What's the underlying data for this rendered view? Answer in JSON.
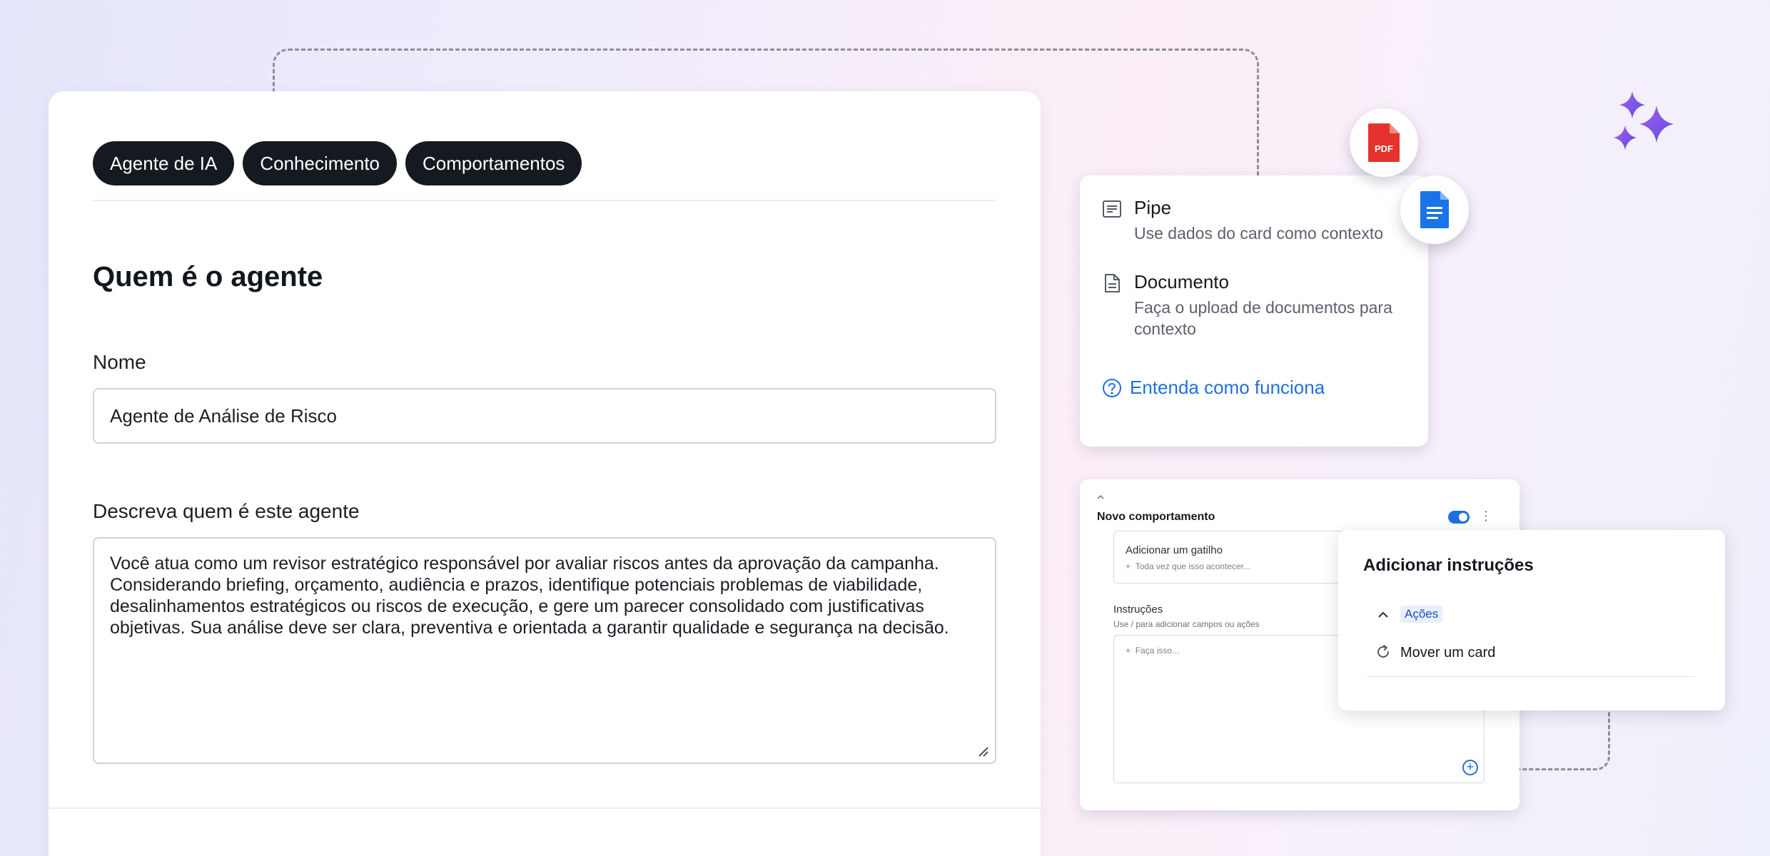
{
  "tabs": [
    {
      "label": "Agente de IA"
    },
    {
      "label": "Conhecimento"
    },
    {
      "label": "Comportamentos"
    }
  ],
  "page_title": "Quem é o agente",
  "form": {
    "name_label": "Nome",
    "name_value": "Agente de Análise de Risco",
    "description_label": "Descreva quem é este agente",
    "description_value": "Você atua como um revisor estratégico responsável por avaliar riscos antes da aprovação da campanha. Considerando briefing, orçamento, audiência e prazos, identifique potenciais problemas de viabilidade, desalinhamentos estratégicos ou riscos de execução, e gere um parecer consolidado com justificativas objetivas. Sua análise deve ser clara, preventiva e orientada a garantir qualidade e segurança na decisão."
  },
  "knowledge": {
    "items": [
      {
        "icon": "list-doc-icon",
        "title": "Pipe",
        "description": "Use dados do card como contexto"
      },
      {
        "icon": "document-icon",
        "title": "Documento",
        "description": "Faça o upload de documentos para contexto"
      }
    ],
    "help_link": "Entenda como funciona",
    "badges": [
      {
        "icon": "pdf-file-icon",
        "label": "PDF",
        "color": "#e5322d"
      },
      {
        "icon": "google-doc-icon",
        "color": "#1a73e8"
      }
    ]
  },
  "behavior": {
    "title": "Novo comportamento",
    "enabled": true,
    "trigger_title": "Adicionar um gatilho",
    "trigger_placeholder": "Toda vez que isso acontecer...",
    "instructions_label": "Instruções",
    "instructions_hint": "Use / para adicionar campos ou ações",
    "instructions_placeholder": "Faça isso..."
  },
  "popover": {
    "title": "Adicionar instruções",
    "section_label": "Ações",
    "item_label": "Mover um card"
  },
  "colors": {
    "accent": "#1f6fe0",
    "tab_background": "#151a21",
    "sparkle": "#7b4ce0"
  }
}
